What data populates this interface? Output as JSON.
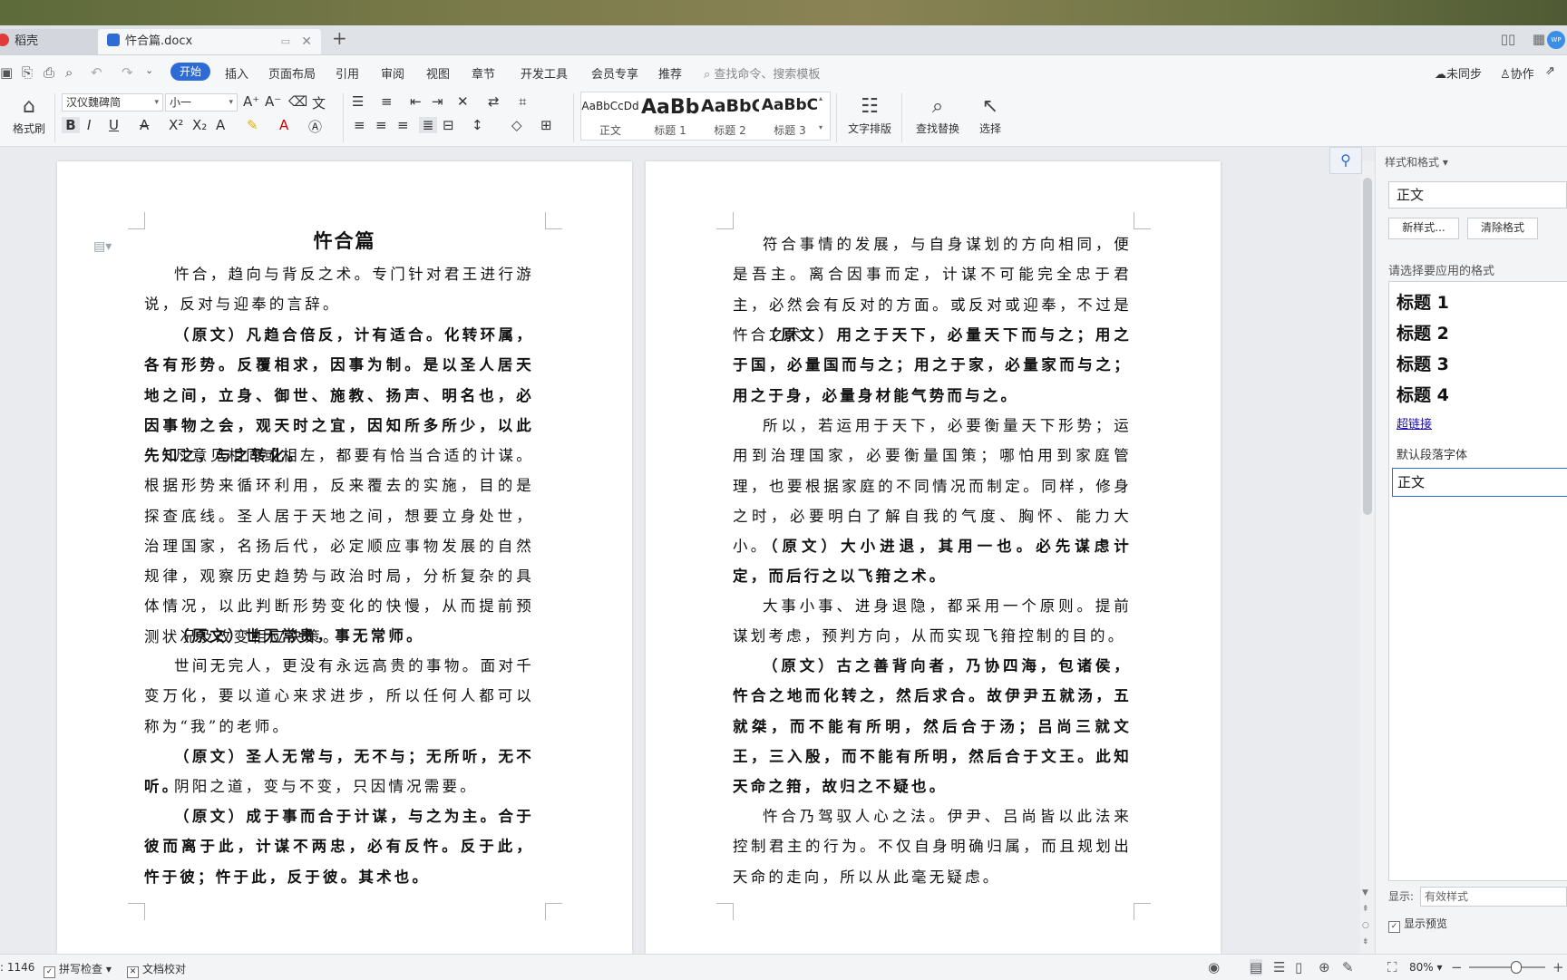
{
  "tabs": [
    {
      "label": "稻壳",
      "active": false
    },
    {
      "label": "忤合篇.docx",
      "active": true
    }
  ],
  "menu": {
    "items": [
      "开始",
      "插入",
      "页面布局",
      "引用",
      "审阅",
      "视图",
      "章节",
      "开发工具",
      "会员专享",
      "推荐"
    ],
    "search_placeholder": "查找命令、搜索模板",
    "right": [
      "未同步",
      "协作"
    ]
  },
  "ribbon": {
    "format_painter": "格式刷",
    "font_name": "汉仪魏碑简",
    "font_size": "小一",
    "styles": [
      {
        "preview": "AaBbCcDd",
        "label": "正文"
      },
      {
        "preview": "AaBb",
        "label": "标题 1"
      },
      {
        "preview": "AaBbC",
        "label": "标题 2"
      },
      {
        "preview": "AaBbC",
        "label": "标题 3"
      }
    ],
    "text_layout": "文字排版",
    "find_replace": "查找替换",
    "select": "选择"
  },
  "document": {
    "title": "忤合篇",
    "page1": [
      {
        "text": "忤合，趋向与背反之术。专门针对君王进行游说，反对与迎奉的言辞。",
        "bold": false
      },
      {
        "text": "（原文）凡趋合倍反，计有适合。化转环属，各有形势。反覆相求，因事为制。是以圣人居天地之间，立身、御世、施教、扬声、明名也，必因事物之会，观天时之宜，因知所多所少，以此先知之，与之转化。",
        "bold": true
      },
      {
        "text": "凡意见相同或相左，都要有恰当合适的计谋。根据形势来循环利用，反来覆去的实施，目的是探查底线。圣人居于天地之间，想要立身处世，治理国家，名扬后代，必定顺应事物发展的自然规律，观察历史趋势与政治时局，分析复杂的具体情况，以此判断形势变化的快慢，从而提前预测状况及改变相应决策。",
        "bold": false
      },
      {
        "text": "（原文）世无常贵，事无常师。",
        "bold": true
      },
      {
        "text": "世间无完人，更没有永远高贵的事物。面对千变万化，要以道心来求进步，所以任何人都可以称为“我”的老师。",
        "bold": false
      },
      {
        "text": "（原文）圣人无常与，无不与；无所听，无不听。",
        "bold": true
      },
      {
        "text": "阴阳之道，变与不变，只因情况需要。",
        "bold": false
      },
      {
        "text": "（原文）成于事而合于计谋，与之为主。合于彼而离于此，计谋不两忠，必有反忤。反于此，忤于彼；忤于此，反于彼。其术也。",
        "bold": true
      }
    ],
    "page2": [
      {
        "text": "符合事情的发展，与自身谋划的方向相同，便是吾主。离合因事而定，计谋不可能完全忠于君主，必然会有反对的方面。或反对或迎奉，不过是忤合之术。",
        "bold": false
      },
      {
        "text": "（原文）用之于天下，必量天下而与之；用之于国，必量国而与之；用之于家，必量家而与之；用之于身，必量身材能气势而与之。",
        "bold": true
      },
      {
        "text": "所以，若运用于天下，必要衡量天下形势；运用到治理国家，必要衡量国策；哪怕用到家庭管理，也要根据家庭的不同情况而制定。同样，修身之时，必要明白了解自我的气度、胸怀、能力大小。",
        "bold": false
      },
      {
        "text": "（原文）大小进退，其用一也。必先谋虑计定，而后行之以飞箝之术。",
        "bold": true
      },
      {
        "text": "大事小事、进身退隐，都采用一个原则。提前谋划考虑，预判方向，从而实现飞箝控制的目的。",
        "bold": false
      },
      {
        "text": "（原文）古之善背向者，乃协四海，包诸侯，忤合之地而化转之，然后求合。故伊尹五就汤，五就桀，而不能有所明，然后合于汤；吕尚三就文王，三入殷，而不能有所明，然后合于文王。此知天命之箝，故归之不疑也。",
        "bold": true
      },
      {
        "text": "忤合乃驾驭人心之法。伊尹、吕尚皆以此法来控制君主的行为。不仅自身明确归属，而且规划出天命的走向，所以从此毫无疑虑。",
        "bold": false
      }
    ]
  },
  "pane": {
    "title": "样式和格式",
    "current_style": "正文",
    "new_style_btn": "新样式...",
    "clear_format_btn": "清除格式",
    "choose_label": "请选择要应用的格式",
    "styles": [
      "标题 1",
      "标题 2",
      "标题 3",
      "标题 4"
    ],
    "hyperlink": "超链接",
    "default_font": "默认段落字体",
    "normal": "正文",
    "show_label": "显示:",
    "show_value": "有效样式",
    "show_preview": "显示预览"
  },
  "status": {
    "word_count": ": 1146",
    "spell_check": "拼写检查",
    "doc_proof": "文档校对",
    "zoom": "80%"
  },
  "colors": {
    "accent": "#2d6bd6",
    "banner": "#7a7a4a"
  }
}
